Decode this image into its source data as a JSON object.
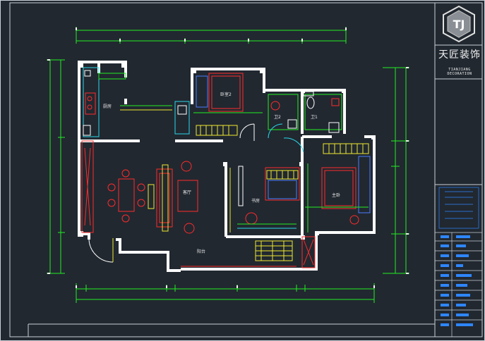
{
  "title_block": {
    "brand_cn": "天匠装饰",
    "brand_en": "TIANJIANG DECORATION",
    "logo_text": "TJ"
  },
  "rooms": {
    "kitchen": "厨房",
    "bedroom2": "卧室2",
    "bathroom2": "卫2",
    "bathroom1": "卫1",
    "living": "客厅",
    "study": "书房",
    "master": "主卧",
    "balcony": "阳台"
  },
  "colors": {
    "background": "#212830",
    "walls": "#ffffff",
    "dimensions": "#22ee22",
    "furniture_red": "#ff2b2b",
    "furniture_yellow": "#f0e830",
    "blue": "#4a7cff",
    "cyan": "#29d8e8"
  }
}
